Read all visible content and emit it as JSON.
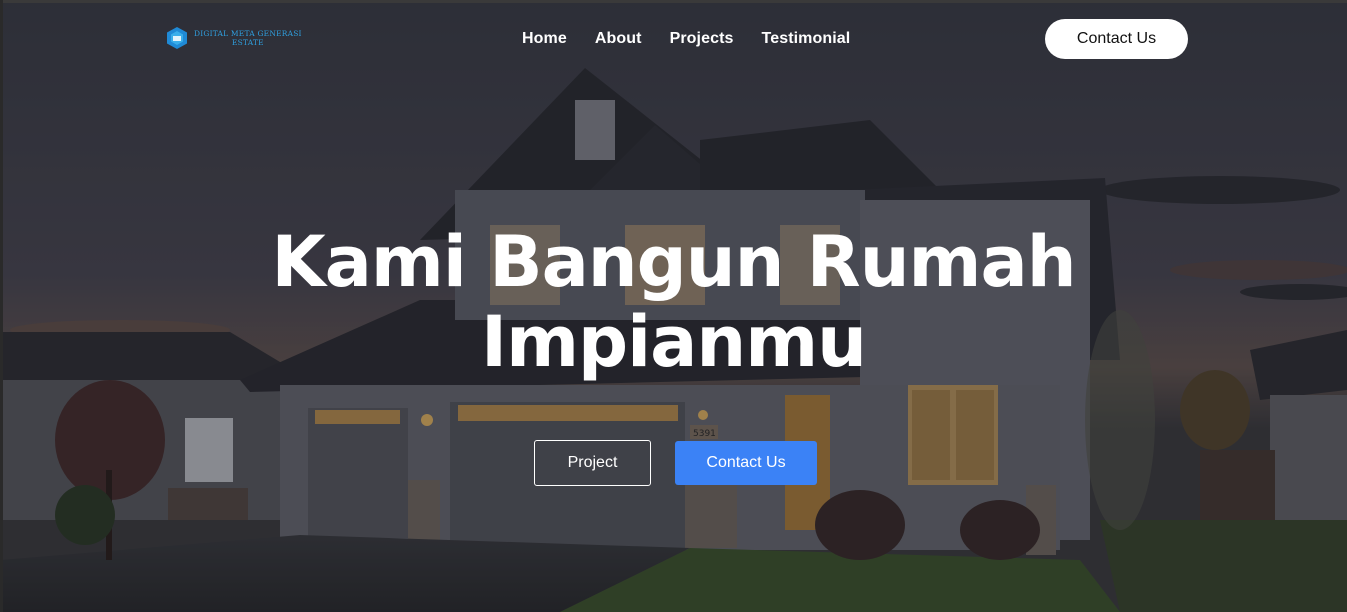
{
  "brand": {
    "logo_line1": "DIGITAL META GENERASI",
    "logo_line2": "ESTATE",
    "logo_color": "#2fa0e0"
  },
  "nav": {
    "links": [
      {
        "label": "Home"
      },
      {
        "label": "About"
      },
      {
        "label": "Projects"
      },
      {
        "label": "Testimonial"
      }
    ],
    "cta_label": "Contact Us"
  },
  "hero": {
    "headline_line1": "Kami Bangun Rumah",
    "headline_line2": "Impianmu",
    "house_number": "5391",
    "buttons": {
      "project_label": "Project",
      "contact_label": "Contact Us"
    }
  },
  "colors": {
    "accent": "#3b82f6",
    "text": "#ffffff"
  }
}
